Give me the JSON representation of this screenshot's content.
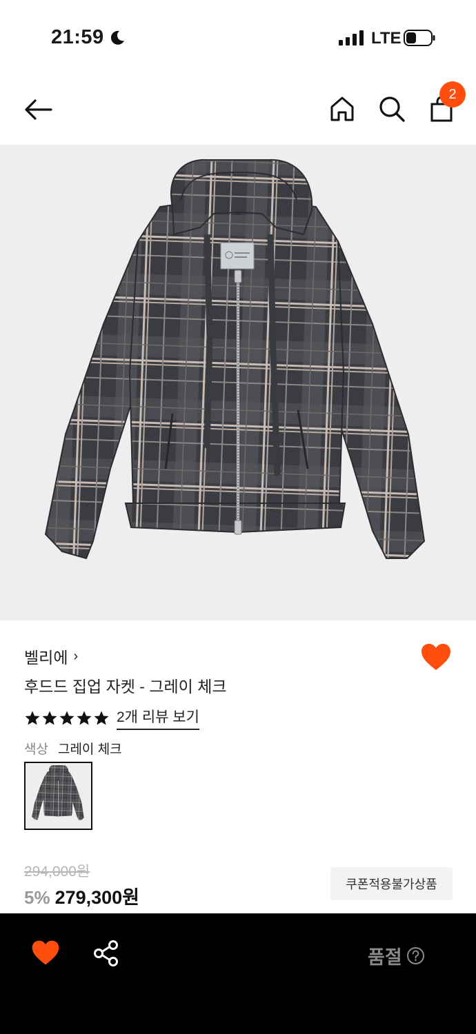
{
  "status_bar": {
    "time": "21:59",
    "network": "LTE",
    "icons": [
      "moon-icon",
      "signal-icon",
      "battery-icon"
    ]
  },
  "nav": {
    "icons": [
      "back-arrow-icon",
      "home-icon",
      "search-icon",
      "shopping-bag-icon"
    ],
    "cart_count": "2"
  },
  "product": {
    "image_icon": "plaid-hooded-zip-jacket",
    "brand": "벨리에",
    "brand_chevron": "›",
    "name": "후드드 집업 자켓 - 그레이 체크",
    "rating_stars": 5,
    "review_link": "2개 리뷰 보기",
    "color_label": "색상",
    "color_value": "그레이 체크",
    "original_price": "294,000원",
    "discount": "5%",
    "price": "279,300원",
    "coupon_notice": "쿠폰적용불가상품",
    "wishlisted": true
  },
  "bottom_bar": {
    "icons": [
      "heart-icon",
      "share-icon",
      "help-icon"
    ],
    "status": "품절"
  },
  "colors": {
    "accent": "#ff4e0e",
    "bottom_bar_bg": "#000000",
    "hero_bg": "#eeeeef"
  }
}
